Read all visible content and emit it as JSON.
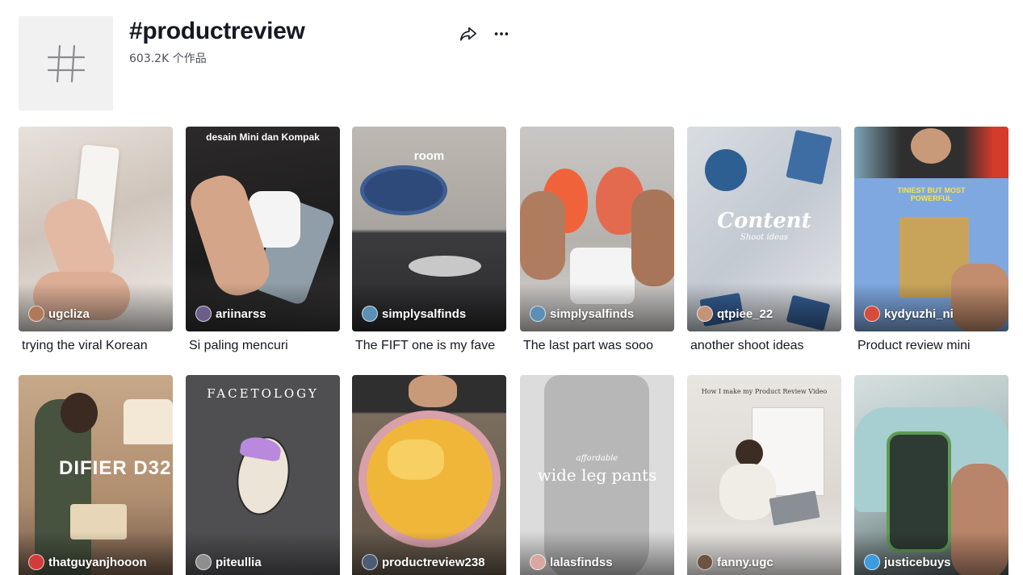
{
  "hashtag": {
    "title": "#productreview",
    "count_text": "603.2K 个作品"
  },
  "icons": {
    "tag": "hash-icon",
    "share": "share-arrow-icon",
    "more": "more-dots-icon"
  },
  "videos": [
    {
      "author": "ugcliza",
      "caption": "trying the viral Korean",
      "overlay": ""
    },
    {
      "author": "ariinarss",
      "caption": "Si paling mencuri",
      "overlay": "desain Mini dan Kompak"
    },
    {
      "author": "simplysalfinds",
      "caption": "The FIFT one is my fave",
      "overlay": "room"
    },
    {
      "author": "simplysalfinds",
      "caption": "The last part was sooo",
      "overlay": ""
    },
    {
      "author": "qtpiee_22",
      "caption": "another shoot ideas",
      "overlay": "Content",
      "overlay_sub": "Shoot ideas"
    },
    {
      "author": "kydyuzhi_ni",
      "caption": "Product review mini",
      "overlay": "TINIEST BUT MOST POWERFUL"
    },
    {
      "author": "thatguyanjhooon",
      "caption": "",
      "overlay": "DIFIER D32"
    },
    {
      "author": "piteullia",
      "caption": "",
      "overlay": "FACETOLOGY"
    },
    {
      "author": "productreview238",
      "caption": "",
      "overlay": ""
    },
    {
      "author": "lalasfindss",
      "caption": "",
      "overlay": "wide leg pants",
      "overlay_sub": "affordable"
    },
    {
      "author": "fanny.ugc",
      "caption": "",
      "overlay": "How I make my Product Review Video"
    },
    {
      "author": "justicebuys",
      "caption": "",
      "overlay": ""
    }
  ]
}
